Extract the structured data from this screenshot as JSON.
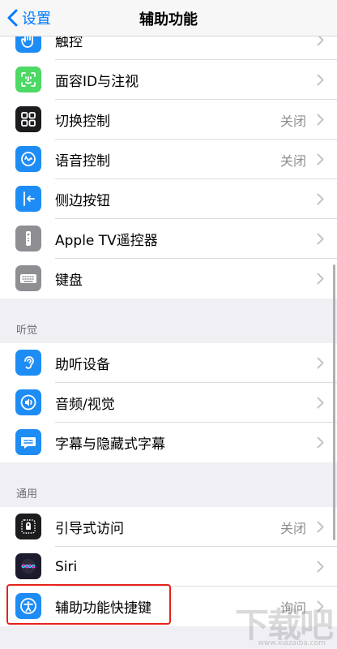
{
  "nav": {
    "back_label": "设置",
    "title": "辅助功能"
  },
  "colors": {
    "accent": "#007aff",
    "highlight": "#e8211c"
  },
  "rows_top": [
    {
      "label": "触控",
      "value": "",
      "icon": "hand-touch-icon",
      "icon_bg": "#1e8cf5"
    },
    {
      "label": "面容ID与注视",
      "value": "",
      "icon": "face-id-icon",
      "icon_bg": "#4cd964"
    },
    {
      "label": "切换控制",
      "value": "关闭",
      "icon": "switch-control-icon",
      "icon_bg": "#1c1c1e"
    },
    {
      "label": "语音控制",
      "value": "关闭",
      "icon": "voice-control-icon",
      "icon_bg": "#1e8cf5"
    },
    {
      "label": "侧边按钮",
      "value": "",
      "icon": "side-button-icon",
      "icon_bg": "#1e8cf5"
    },
    {
      "label": "Apple TV遥控器",
      "value": "",
      "icon": "tv-remote-icon",
      "icon_bg": "#8e8e93"
    },
    {
      "label": "键盘",
      "value": "",
      "icon": "keyboard-icon",
      "icon_bg": "#8e8e93"
    }
  ],
  "section_hearing": {
    "header": "听觉",
    "rows": [
      {
        "label": "助听设备",
        "value": "",
        "icon": "ear-icon",
        "icon_bg": "#1e8cf5"
      },
      {
        "label": "音频/视觉",
        "value": "",
        "icon": "audio-visual-icon",
        "icon_bg": "#1e8cf5"
      },
      {
        "label": "字幕与隐藏式字幕",
        "value": "",
        "icon": "subtitles-icon",
        "icon_bg": "#1e8cf5"
      }
    ]
  },
  "section_general": {
    "header": "通用",
    "rows": [
      {
        "label": "引导式访问",
        "value": "关闭",
        "icon": "guided-access-icon",
        "icon_bg": "#1c1c1e"
      },
      {
        "label": "Siri",
        "value": "",
        "icon": "siri-icon",
        "icon_bg": "#1c1c2e"
      },
      {
        "label": "辅助功能快捷键",
        "value": "询问",
        "icon": "accessibility-icon",
        "icon_bg": "#1e8cf5"
      }
    ]
  },
  "watermark": {
    "text": "下载吧",
    "sub": "www.xiazaiba.com"
  }
}
